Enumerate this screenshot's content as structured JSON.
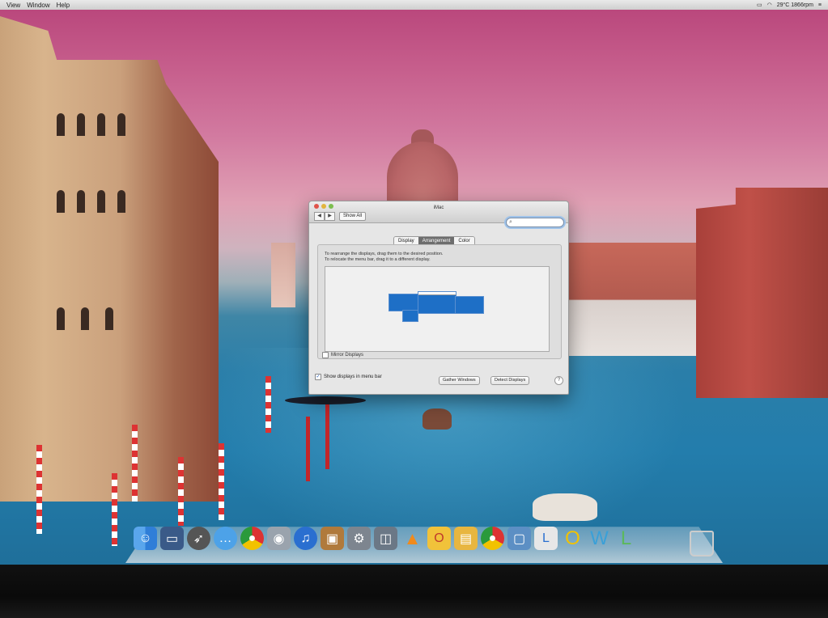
{
  "menubar": {
    "items": [
      "View",
      "Window",
      "Help"
    ],
    "status_text": "29°C 1866rpm"
  },
  "dialog": {
    "title": "iMac",
    "show_all": "Show All",
    "nav_back": "◀",
    "nav_forward": "▶",
    "search_placeholder": "",
    "tabs": [
      {
        "label": "Display",
        "active": false
      },
      {
        "label": "Arrangement",
        "active": true
      },
      {
        "label": "Color",
        "active": false
      }
    ],
    "instructions_line1": "To rearrange the displays, drag them to the desired position.",
    "instructions_line2": "To relocate the menu bar, drag it to a different display.",
    "mirror_label": "Mirror Displays",
    "mirror_checked": false,
    "show_in_menubar_label": "Show displays in menu bar",
    "show_in_menubar_checked": true,
    "gather_button": "Gather Windows",
    "detect_button": "Detect Displays",
    "help": "?",
    "accent_color": "#1e6fc6"
  },
  "dock": {
    "icons": [
      "finder-icon",
      "system-profiler-icon",
      "rocket-icon",
      "messages-icon",
      "chrome-icon",
      "facetime-icon",
      "itunes-icon",
      "iphoto-icon",
      "system-preferences-icon",
      "image-capture-icon",
      "vlc-icon",
      "office-icon",
      "folder-icon",
      "chrome-icon",
      "preview-icon",
      "office-l-icon",
      "o-icon",
      "w-icon",
      "l-icon"
    ]
  }
}
